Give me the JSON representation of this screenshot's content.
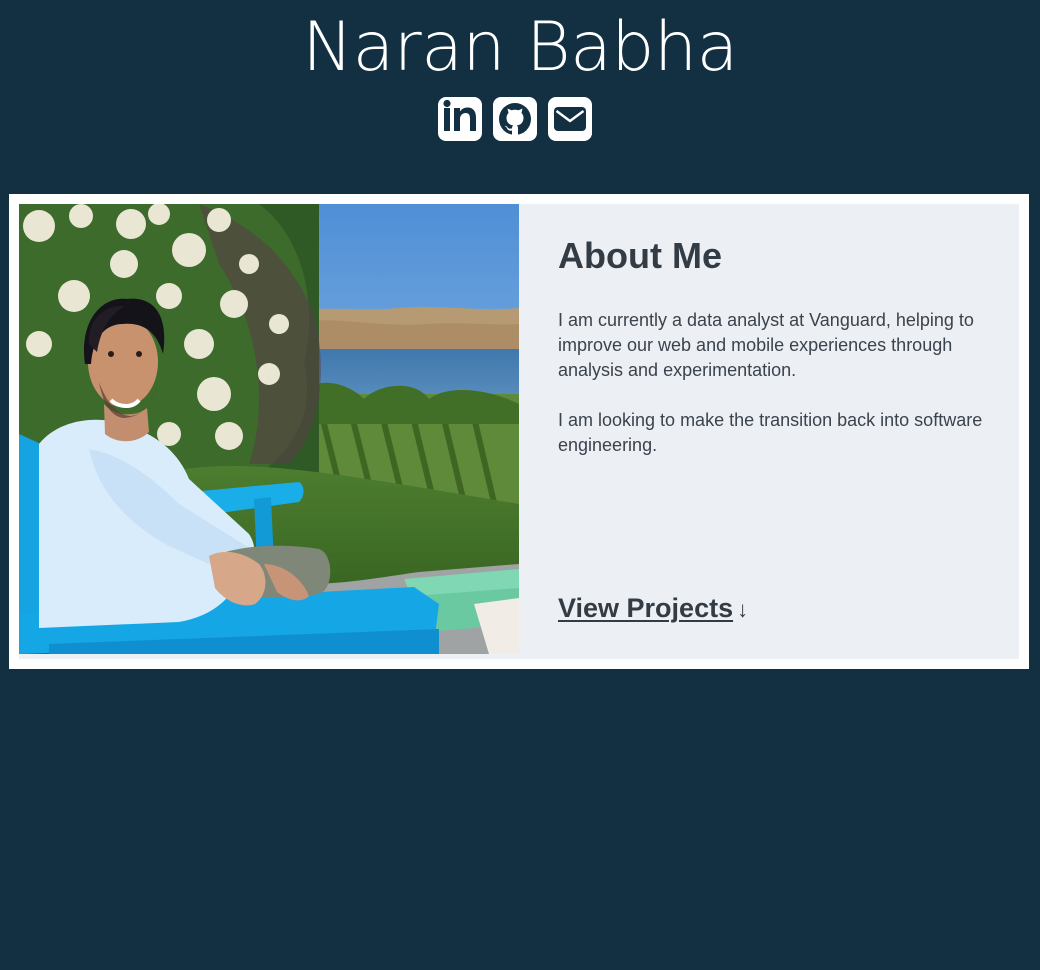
{
  "header": {
    "title": "Naran Babha",
    "social_links": [
      {
        "name": "linkedin",
        "icon": "linkedin-icon"
      },
      {
        "name": "github",
        "icon": "github-icon"
      },
      {
        "name": "email",
        "icon": "envelope-icon"
      }
    ]
  },
  "about": {
    "heading": "About Me",
    "paragraphs": [
      "I am currently a data analyst at Vanguard, helping to improve our web and mobile experiences through analysis and experimentation.",
      "I am looking to make the transition back into software engineering."
    ],
    "cta_label": "View Projects",
    "cta_icon": "arrow-down-icon",
    "cta_arrow": "↓"
  },
  "colors": {
    "background": "#133042",
    "card": "#eceff3",
    "text": "#333b44",
    "icon_bg": "#ffffff"
  }
}
